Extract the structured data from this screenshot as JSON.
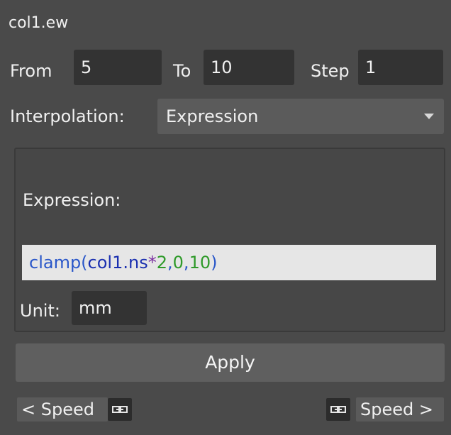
{
  "title": "col1.ew",
  "range": {
    "from_label": "From",
    "from_value": "5",
    "to_label": "To",
    "to_value": "10",
    "step_label": "Step",
    "step_value": "1"
  },
  "interpolation": {
    "label": "Interpolation:",
    "selected": "Expression"
  },
  "expression": {
    "label": "Expression:",
    "tokens": [
      "clamp(",
      "col1.ns",
      "*",
      "2",
      ",",
      "0",
      ",",
      "10",
      ")"
    ]
  },
  "unit": {
    "label": "Unit:",
    "value": "mm"
  },
  "apply_label": "Apply",
  "speed_left_label": "< Speed",
  "speed_right_label": "Speed >",
  "colors": {
    "background": "#4a4a4a",
    "field_bg": "#333333",
    "expression_bg": "#e6e6e6",
    "button_bg": "#5f5f5f"
  },
  "icons": {
    "link": "link-icon",
    "dropdown": "chevron-down-icon"
  }
}
